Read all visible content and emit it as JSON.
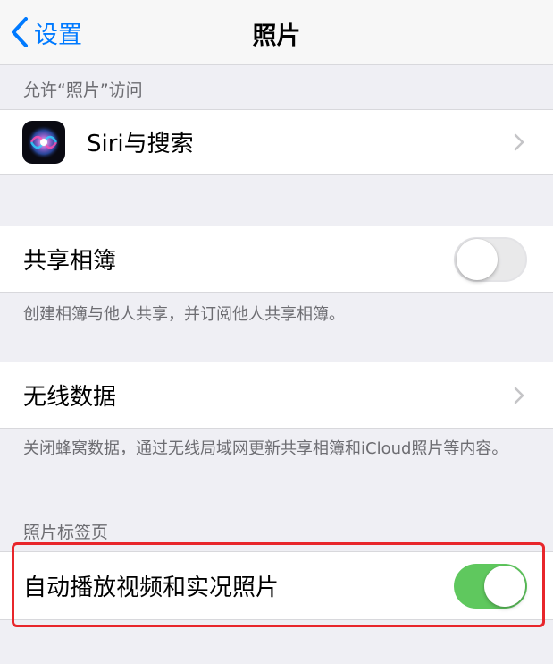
{
  "navbar": {
    "back_label": "设置",
    "title": "照片"
  },
  "access_section": {
    "header": "允许“照片”访问",
    "siri_item": {
      "label": "Siri与搜索",
      "icon": "siri-icon"
    }
  },
  "shared_albums": {
    "label": "共享相簿",
    "enabled": false,
    "footer": "创建相簿与他人共享，并订阅他人共享相簿。"
  },
  "cellular": {
    "label": "无线数据",
    "footer": "关闭蜂窝数据，通过无线局域网更新共享相簿和iCloud照片等内容。"
  },
  "photos_tab": {
    "header": "照片标签页",
    "autoplay": {
      "label": "自动播放视频和实况照片",
      "enabled": true
    }
  },
  "colors": {
    "accent": "#007aff",
    "toggle_on": "#5fc85e",
    "highlight": "#e8262b",
    "background": "#efeff4"
  }
}
